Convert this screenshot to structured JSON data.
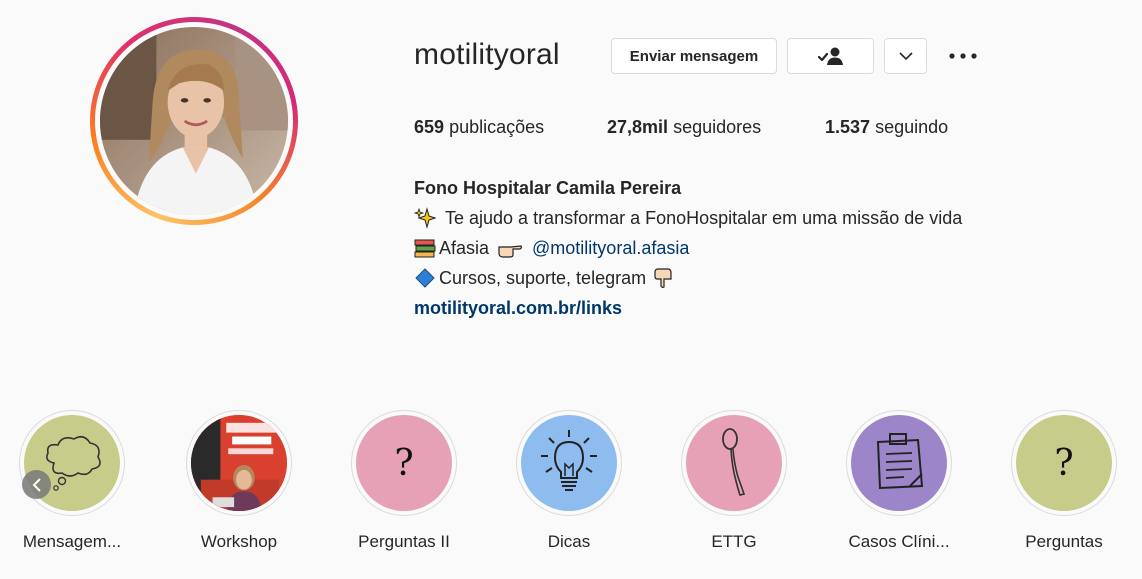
{
  "profile": {
    "username": "motilityoral",
    "buttons": {
      "message": "Enviar mensagem",
      "following_icon": "person-check-icon",
      "dropdown_icon": "chevron-down-icon",
      "more_icon": "more-dots-icon"
    },
    "stats": {
      "posts_count": "659",
      "posts_label": "publicações",
      "followers_count": "27,8mil",
      "followers_label": "seguidores",
      "following_count": "1.537",
      "following_label": "seguindo"
    },
    "bio": {
      "name": "Fono Hospitalar Camila Pereira",
      "line1": "Te ajudo a transformar a FonoHospitalar em uma missão de vida",
      "line2_text": "Afasia",
      "line2_mention": "@motilityoral.afasia",
      "line3": "Cursos, suporte, telegram",
      "link": "motilityoral.com.br/links"
    }
  },
  "highlights": [
    {
      "label": "Mensagem...",
      "bg": "#c8cc8a",
      "icon": "thought-cloud-icon"
    },
    {
      "label": "Workshop",
      "bg": "#e04a3a",
      "icon": "workshop-photo"
    },
    {
      "label": "Perguntas II",
      "bg": "#e6a1b6",
      "icon": "question-mark-icon",
      "glyph": "?"
    },
    {
      "label": "Dicas",
      "bg": "#8fbcee",
      "icon": "lightbulb-icon"
    },
    {
      "label": "ETTG",
      "bg": "#e6a1b6",
      "icon": "spoon-icon"
    },
    {
      "label": "Casos Clíni...",
      "bg": "#9c86c9",
      "icon": "clipboard-icon"
    },
    {
      "label": "Perguntas",
      "bg": "#c8cc8a",
      "icon": "question-mark-icon",
      "glyph": "?"
    }
  ],
  "nav": {
    "prev_icon": "chevron-left-icon"
  }
}
